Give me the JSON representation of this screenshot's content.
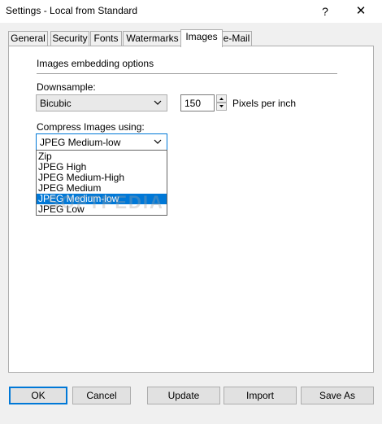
{
  "window": {
    "title": "Settings - Local from Standard",
    "help": "?",
    "close": "✕"
  },
  "tabs": [
    "General",
    "Security",
    "Fonts",
    "Watermarks",
    "Images",
    "e-Mail"
  ],
  "active_tab": "Images",
  "images": {
    "section_title": "Images embedding options",
    "downsample_label": "Downsample:",
    "downsample_value": "Bicubic",
    "resolution_value": "150",
    "resolution_unit": "Pixels per inch",
    "compress_label": "Compress Images using:",
    "compress_value": "JPEG Medium-low",
    "compress_options": [
      "Zip",
      "JPEG High",
      "JPEG Medium-High",
      "JPEG Medium",
      "JPEG Medium-low",
      "JPEG Low"
    ],
    "compress_selected_index": 4
  },
  "watermark": "SOFTPEDIA",
  "buttons": {
    "ok": "OK",
    "cancel": "Cancel",
    "update": "Update",
    "import": "Import",
    "save_as": "Save As"
  },
  "colors": {
    "accent": "#0078d7"
  }
}
